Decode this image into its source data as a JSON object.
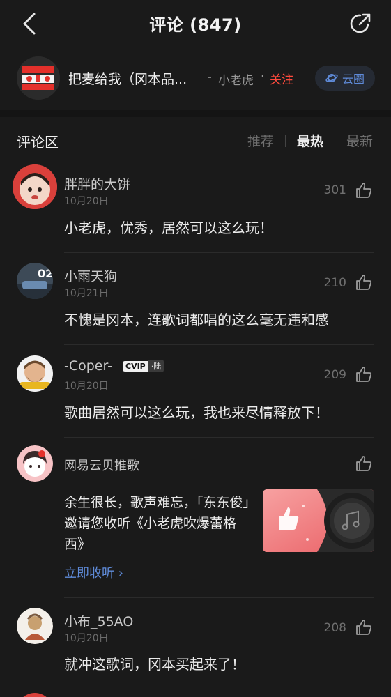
{
  "header": {
    "title": "评论 (847)"
  },
  "song": {
    "title": "把麦给我（冈本品...",
    "separator": "-",
    "artist": "小老虎",
    "dot": "·",
    "follow_label": "关注",
    "yunquan_label": "云圈"
  },
  "section": {
    "title": "评论区",
    "tabs": [
      {
        "label": "推荐",
        "active": false
      },
      {
        "label": "最热",
        "active": true
      },
      {
        "label": "最新",
        "active": false
      }
    ]
  },
  "comments": [
    {
      "name": "胖胖的大饼",
      "date": "10月20日",
      "likes": "301",
      "text": "小老虎，优秀，居然可以这么玩！"
    },
    {
      "name": "小雨天狗",
      "date": "10月21日",
      "likes": "210",
      "text": "不愧是冈本，连歌词都唱的这么毫无违和感"
    },
    {
      "name": "-Coper-",
      "date": "10月20日",
      "likes": "209",
      "text": "歌曲居然可以这么玩，我也来尽情释放下！",
      "badge_left": "CVIP",
      "badge_right": "·陆"
    },
    {
      "name": "小布_55AO",
      "date": "10月20日",
      "likes": "208",
      "text": "就冲这歌词，冈本买起来了！"
    }
  ],
  "recommend": {
    "name": "网易云贝推歌",
    "text": "余生很长，歌声难忘，「东东俊」邀请您收听《小老虎吹爆蕾格西》",
    "link": "立即收听 ›"
  },
  "colors": {
    "background": "#1a1a1a",
    "accent_red": "#ff4a3d",
    "link_blue": "#5f8bd9"
  }
}
